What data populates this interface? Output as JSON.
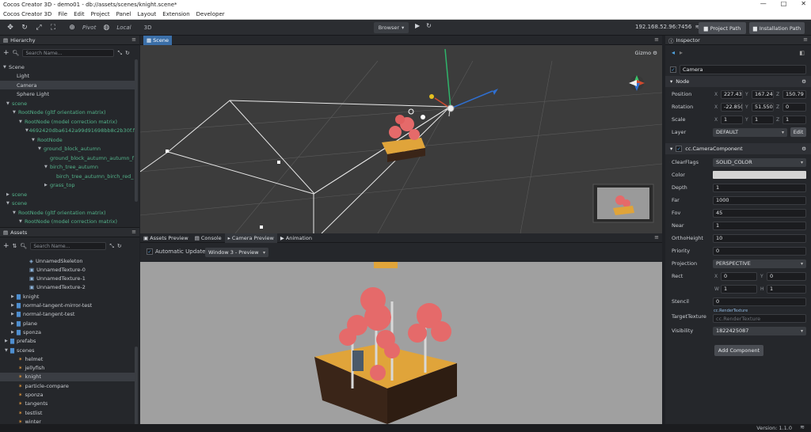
{
  "window": {
    "title": "Cocos Creator 3D - demo01 - db://assets/scenes/knight.scene*",
    "controls": [
      "—",
      "□",
      "✕"
    ]
  },
  "menu": [
    "Cocos Creator 3D",
    "File",
    "Edit",
    "Project",
    "Panel",
    "Layout",
    "Extension",
    "Developer"
  ],
  "toolbar": {
    "pivot_label": "Pivot",
    "local_label": "Local",
    "mode_label": "3D",
    "browser_label": "Browser",
    "ip": "192.168.52.96:7456",
    "project_path_label": "Project Path",
    "install_path_label": "Installation Path"
  },
  "hierarchy": {
    "title": "Hierarchy",
    "search_placeholder": "Search Name...",
    "rows": [
      {
        "label": "Scene",
        "arrow": "▼",
        "green": false
      },
      {
        "label": "Light",
        "arrow": "",
        "green": false
      },
      {
        "label": "Camera",
        "arrow": "",
        "green": false
      },
      {
        "label": "Sphere Light",
        "arrow": "",
        "green": false
      },
      {
        "label": "scene",
        "arrow": "▼",
        "green": true
      },
      {
        "label": "RootNode (gltf orientation matrix)",
        "arrow": "▼",
        "green": true
      },
      {
        "label": "RootNode (model correction matrix)",
        "arrow": "▼",
        "green": true
      },
      {
        "label": "4692420dba6142a99d91698bb8c2b30f.f",
        "arrow": "▼",
        "green": true
      },
      {
        "label": "RootNode",
        "arrow": "▼",
        "green": true
      },
      {
        "label": "ground_block_autumn",
        "arrow": "▼",
        "green": true
      },
      {
        "label": "ground_block_autumn_autumn_f",
        "arrow": "",
        "green": true
      },
      {
        "label": "birch_tree_autumn",
        "arrow": "▼",
        "green": true
      },
      {
        "label": "birch_tree_autumn_birch_red_",
        "arrow": "",
        "green": true
      },
      {
        "label": "grass_top",
        "arrow": "▶",
        "green": true
      },
      {
        "label": "scene",
        "arrow": "▶",
        "green": true
      },
      {
        "label": "scene",
        "arrow": "▼",
        "green": true
      },
      {
        "label": "RootNode (gltf orientation matrix)",
        "arrow": "▼",
        "green": true
      },
      {
        "label": "RootNode (model correction matrix)",
        "arrow": "▼",
        "green": true
      }
    ]
  },
  "assets": {
    "title": "Assets",
    "search_placeholder": "Search Name...",
    "rows": [
      {
        "label": "UnnamedSkeleton",
        "arrow": "",
        "icon": "◈"
      },
      {
        "label": "UnnamedTexture-0",
        "arrow": "",
        "icon": "▣"
      },
      {
        "label": "UnnamedTexture-1",
        "arrow": "",
        "icon": "▣"
      },
      {
        "label": "UnnamedTexture-2",
        "arrow": "",
        "icon": "▣"
      },
      {
        "label": "knight",
        "arrow": "▶",
        "icon": "▇"
      },
      {
        "label": "normal-tangent-mirror-test",
        "arrow": "▶",
        "icon": "▇"
      },
      {
        "label": "normal-tangent-test",
        "arrow": "▶",
        "icon": "▇"
      },
      {
        "label": "plane",
        "arrow": "▶",
        "icon": "▇"
      },
      {
        "label": "sponza",
        "arrow": "▶",
        "icon": "▇"
      },
      {
        "label": "prefabs",
        "arrow": "▶",
        "icon": "▇"
      },
      {
        "label": "scenes",
        "arrow": "▼",
        "icon": "▇"
      },
      {
        "label": "helmet",
        "arrow": "",
        "icon": "✶"
      },
      {
        "label": "jellyfish",
        "arrow": "",
        "icon": "✶"
      },
      {
        "label": "knight",
        "arrow": "",
        "icon": "✶"
      },
      {
        "label": "particle-compare",
        "arrow": "",
        "icon": "✶"
      },
      {
        "label": "sponza",
        "arrow": "",
        "icon": "✶"
      },
      {
        "label": "tangents",
        "arrow": "",
        "icon": "✶"
      },
      {
        "label": "testlist",
        "arrow": "",
        "icon": "✶"
      },
      {
        "label": "winter",
        "arrow": "",
        "icon": "✶"
      }
    ]
  },
  "scene": {
    "tab": "Scene",
    "gizmo_label": "Gizmo"
  },
  "preview": {
    "tabs": [
      "Assets Preview",
      "Console",
      "Camera Preview",
      "Animation"
    ],
    "auto_updates_label": "Automatic Updates",
    "window_select": "Window 3 - Preview"
  },
  "inspector": {
    "title": "Inspector",
    "node_name": "Camera",
    "node_section": "Node",
    "position": {
      "label": "Position",
      "x": "227.43",
      "y": "167.24",
      "z": "150.79"
    },
    "rotation": {
      "label": "Rotation",
      "x": "-22.85(",
      "y": "51.550",
      "z": "0"
    },
    "scale": {
      "label": "Scale",
      "x": "1",
      "y": "1",
      "z": "1"
    },
    "layer": {
      "label": "Layer",
      "value": "DEFAULT",
      "edit": "Edit"
    },
    "component_title": "cc.CameraComponent",
    "props": {
      "clearflags_label": "ClearFlags",
      "clearflags": "SOLID_COLOR",
      "color_label": "Color",
      "depth_label": "Depth",
      "depth": "1",
      "far_label": "Far",
      "far": "1000",
      "fov_label": "Fov",
      "fov": "45",
      "near_label": "Near",
      "near": "1",
      "orthoheight_label": "OrthoHeight",
      "orthoheight": "10",
      "priority_label": "Priority",
      "priority": "0",
      "projection_label": "Projection",
      "projection": "PERSPECTIVE",
      "rect_label": "Rect",
      "rect_x": "0",
      "rect_y": "0",
      "rect_w": "1",
      "rect_h": "1",
      "stencil_label": "Stencil",
      "stencil": "0",
      "targettexture_label": "TargetTexture",
      "targettexture_type": "cc.RenderTexture",
      "targettexture_value": "cc.RenderTexture",
      "visibility_label": "Visibility",
      "visibility": "1822425087"
    },
    "add_component": "Add Component"
  },
  "status": {
    "version": "Version: 1.1.0"
  },
  "colors": {
    "accent": "#3b6fa8",
    "node_green": "#53b38a"
  }
}
